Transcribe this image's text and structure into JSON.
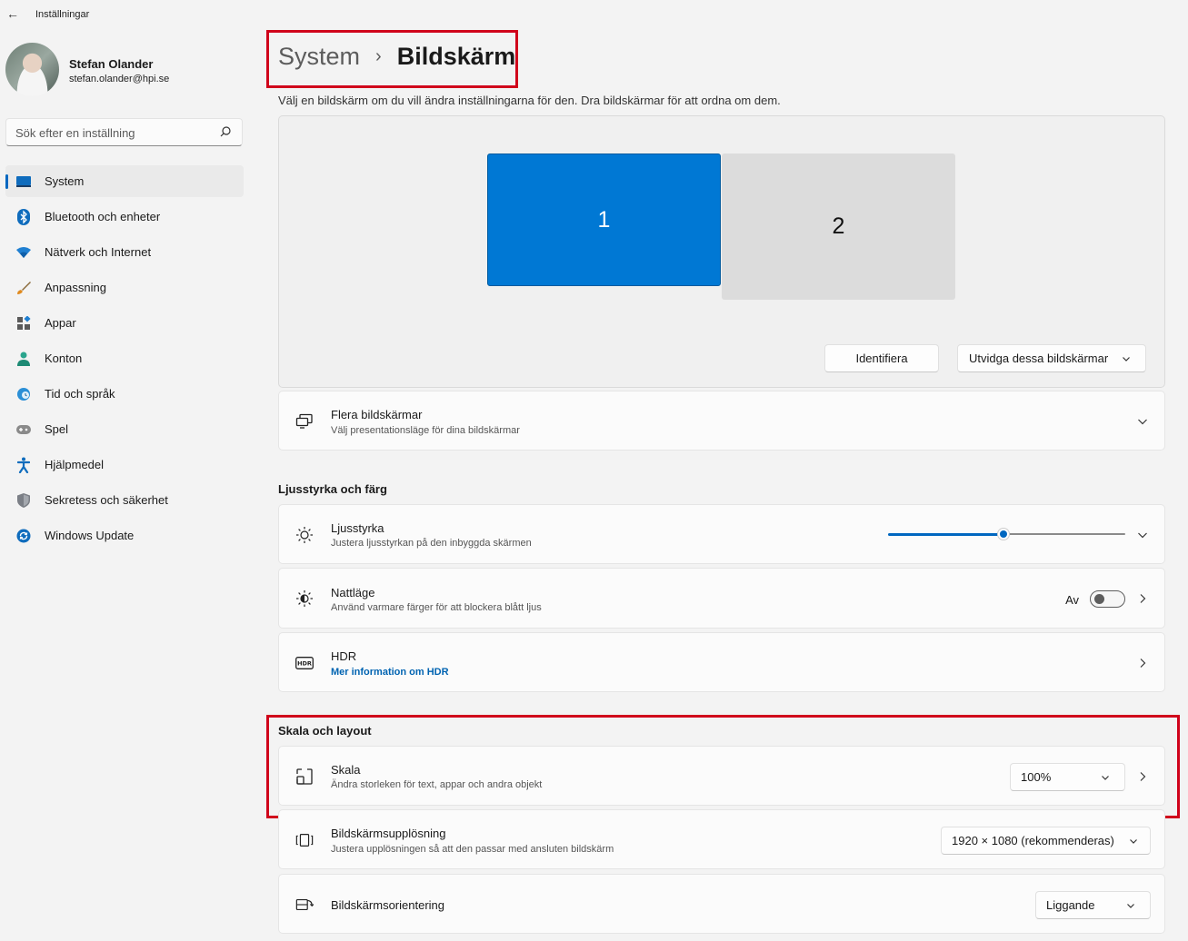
{
  "app": {
    "title": "Inställningar"
  },
  "profile": {
    "name": "Stefan Olander",
    "email": "stefan.olander@hpi.se"
  },
  "search": {
    "placeholder": "Sök efter en inställning"
  },
  "nav": [
    {
      "label": "System",
      "icon": "system-icon",
      "selected": true
    },
    {
      "label": "Bluetooth och enheter",
      "icon": "bluetooth-icon"
    },
    {
      "label": "Nätverk och Internet",
      "icon": "wifi-icon"
    },
    {
      "label": "Anpassning",
      "icon": "brush-icon"
    },
    {
      "label": "Appar",
      "icon": "apps-icon"
    },
    {
      "label": "Konton",
      "icon": "person-icon"
    },
    {
      "label": "Tid och språk",
      "icon": "globe-clock-icon"
    },
    {
      "label": "Spel",
      "icon": "gamepad-icon"
    },
    {
      "label": "Hjälpmedel",
      "icon": "accessibility-icon"
    },
    {
      "label": "Sekretess och säkerhet",
      "icon": "shield-icon"
    },
    {
      "label": "Windows Update",
      "icon": "update-icon"
    }
  ],
  "breadcrumb": {
    "parent": "System",
    "separator": "›",
    "current": "Bildskärm"
  },
  "description": "Välj en bildskärm om du vill ändra inställningarna för den. Dra bildskärmar för att ordna om dem.",
  "monitors": {
    "primary": "1",
    "secondary": "2",
    "identify": "Identifiera",
    "mode": "Utvidga dessa bildskärmar"
  },
  "multi": {
    "title": "Flera bildskärmar",
    "subtitle": "Välj presentationsläge för dina bildskärmar"
  },
  "brightness_section": {
    "title": "Ljusstyrka och färg",
    "brightness": {
      "title": "Ljusstyrka",
      "subtitle": "Justera ljusstyrkan på den inbyggda skärmen",
      "value_fraction": 0.52
    },
    "night": {
      "title": "Nattläge",
      "subtitle": "Använd varmare färger för att blockera blått ljus",
      "state": "Av"
    },
    "hdr": {
      "title": "HDR",
      "link": "Mer information om HDR"
    }
  },
  "scale_section": {
    "title": "Skala och layout",
    "scale": {
      "title": "Skala",
      "subtitle": "Ändra storleken för text, appar och andra objekt",
      "value": "100%"
    },
    "resolution": {
      "title": "Bildskärmsupplösning",
      "subtitle": "Justera  upplösningen så att den passar med  ansluten bildskärm",
      "value": "1920 × 1080 (rekommenderas)"
    },
    "orientation": {
      "title": "Bildskärmsorientering",
      "value": "Liggande"
    }
  },
  "colors": {
    "accent": "#0067c0",
    "monitor_primary": "#0078d4",
    "highlight": "#d0021b"
  }
}
